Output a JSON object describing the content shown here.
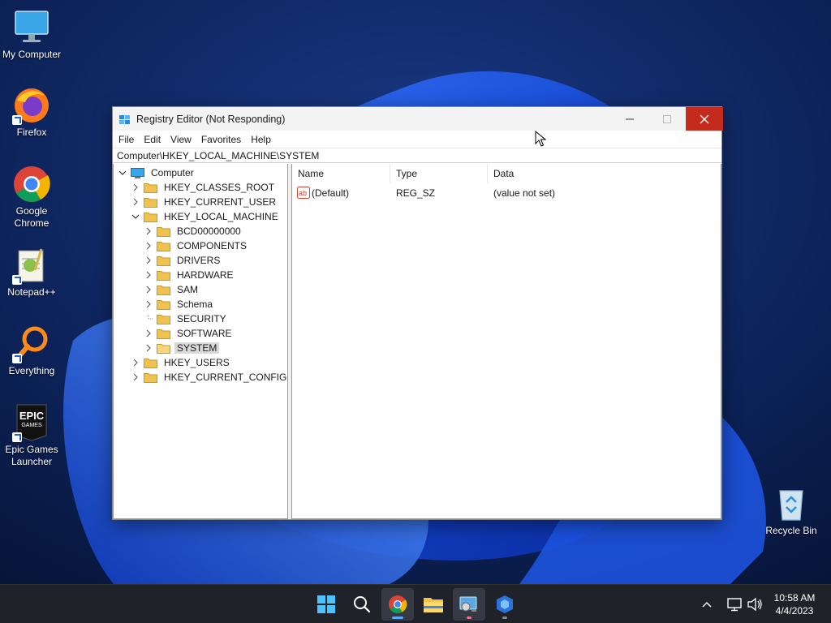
{
  "desktop": {
    "icons": [
      {
        "label": "My Computer"
      },
      {
        "label": "Firefox"
      },
      {
        "label": "Google Chrome"
      },
      {
        "label": "Notepad++"
      },
      {
        "label": "Everything"
      },
      {
        "label": "Epic Games Launcher"
      },
      {
        "label": "Recycle Bin"
      }
    ],
    "epic_logo_top": "EPIC",
    "epic_logo_bottom": "GAMES"
  },
  "window": {
    "title": "Registry Editor (Not Responding)",
    "menu": [
      "File",
      "Edit",
      "View",
      "Favorites",
      "Help"
    ],
    "address": "Computer\\HKEY_LOCAL_MACHINE\\SYSTEM",
    "tree": {
      "root": "Computer",
      "hives": [
        {
          "label": "HKEY_CLASSES_ROOT"
        },
        {
          "label": "HKEY_CURRENT_USER"
        },
        {
          "label": "HKEY_LOCAL_MACHINE"
        },
        {
          "label": "HKEY_USERS"
        },
        {
          "label": "HKEY_CURRENT_CONFIG"
        }
      ],
      "hklm_children": [
        {
          "label": "BCD00000000"
        },
        {
          "label": "COMPONENTS"
        },
        {
          "label": "DRIVERS"
        },
        {
          "label": "HARDWARE"
        },
        {
          "label": "SAM"
        },
        {
          "label": "Schema"
        },
        {
          "label": "SECURITY"
        },
        {
          "label": "SOFTWARE"
        },
        {
          "label": "SYSTEM"
        }
      ],
      "selected": "SYSTEM"
    },
    "columns": [
      "Name",
      "Type",
      "Data"
    ],
    "values": [
      {
        "name": "(Default)",
        "type": "REG_SZ",
        "data": "(value not set)"
      }
    ]
  },
  "taskbar": {
    "apps": [
      "start-icon",
      "search-icon",
      "chrome-icon",
      "file-explorer-icon",
      "registry-editor-icon",
      "app-icon"
    ],
    "time": "10:58 AM",
    "date": "4/4/2023"
  },
  "colors": {
    "close_button": "#c42b1c",
    "taskbar": "#1f2229",
    "selection": "#d9d9d9",
    "folder": "#f0c350"
  }
}
